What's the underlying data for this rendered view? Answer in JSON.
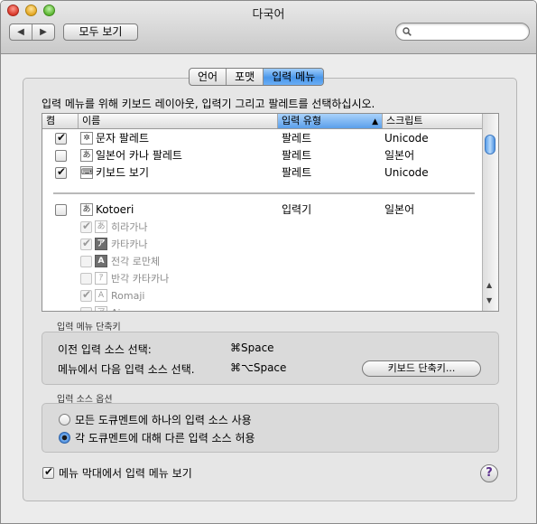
{
  "window": {
    "title": "다국어"
  },
  "toolbar": {
    "back_icon": "back-arrow",
    "forward_icon": "forward-arrow",
    "show_all_label": "모두 보기",
    "search_value": ""
  },
  "tabs": [
    {
      "label": "언어",
      "selected": false
    },
    {
      "label": "포맷",
      "selected": false
    },
    {
      "label": "입력 메뉴",
      "selected": true
    }
  ],
  "instruction": "입력 메뉴를 위해 키보드 레이아웃, 입력기 그리고 팔레트를 선택하십시오.",
  "table": {
    "columns": [
      "켬",
      "이름",
      "입력 유형",
      "스크립트"
    ],
    "sort_arrow": "▲",
    "rows": [
      {
        "checked": true,
        "icon": "✲",
        "name": "문자 팔레트",
        "type": "팔레트",
        "script": "Unicode"
      },
      {
        "checked": false,
        "icon": "あ",
        "name": "일본어 카나 팔레트",
        "type": "팔레트",
        "script": "일본어"
      },
      {
        "checked": true,
        "icon": "⌨",
        "name": "키보드 보기",
        "type": "팔레트",
        "script": "Unicode"
      },
      {
        "checked": false,
        "icon": "あ",
        "name": "Kotoeri",
        "type": "입력기",
        "script": "일본어"
      }
    ],
    "subrows": [
      {
        "checked": true,
        "icon": "あ",
        "name": "히라가나"
      },
      {
        "checked": true,
        "icon": "ア",
        "name": "카타카나"
      },
      {
        "checked": false,
        "icon": "A",
        "name": "전각 로만체"
      },
      {
        "checked": false,
        "icon": "ｱ",
        "name": "반각 카타카나"
      },
      {
        "checked": true,
        "icon": "A",
        "name": "Romaji"
      },
      {
        "checked": false,
        "icon": "ア",
        "name": "Ainu"
      }
    ]
  },
  "shortcuts": {
    "label": "입력 메뉴 단축키",
    "prev_label": "이전 입력 소스 선택:",
    "prev_key": "⌘Space",
    "next_label": "메뉴에서 다음 입력 소스 선택.",
    "next_key": "⌘⌥Space",
    "button": "키보드 단축키..."
  },
  "options": {
    "label": "입력 소스 옵션",
    "radio1": "모든 도큐멘트에 하나의 입력 소스 사용",
    "radio2": "각 도큐멘트에 대해 다른 입력 소스 허용",
    "selected": 2
  },
  "show_in_menubar": {
    "checked": true,
    "label": "메뉴 막대에서 입력 메뉴 보기"
  },
  "help_label": "?"
}
